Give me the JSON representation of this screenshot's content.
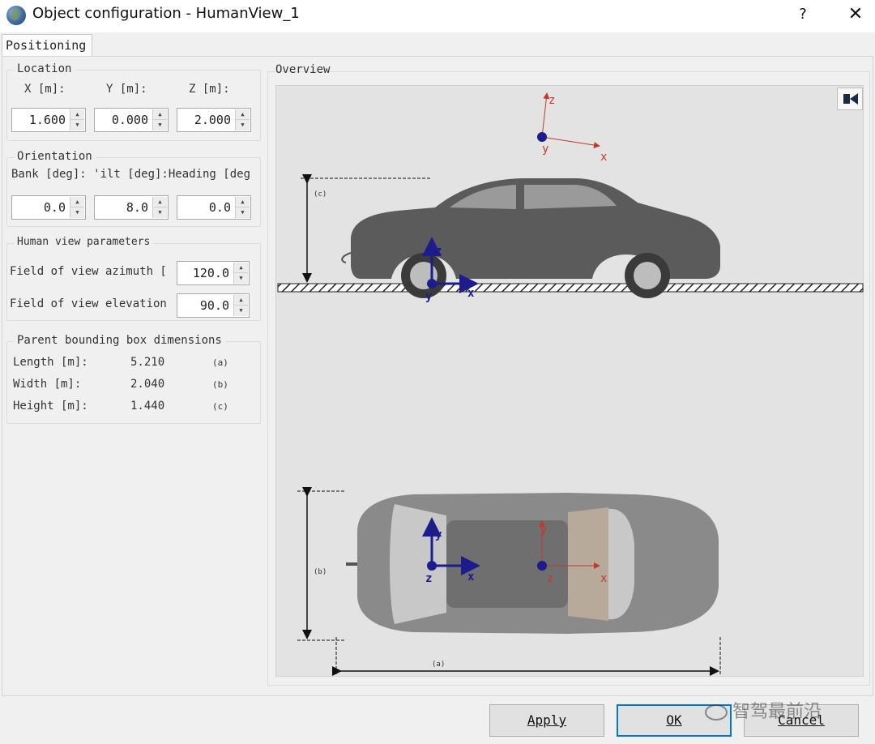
{
  "window": {
    "title": "Object configuration - HumanView_1",
    "help_label": "?",
    "close_label": "✕"
  },
  "tabs": [
    {
      "label": "Positioning"
    }
  ],
  "location": {
    "title": "Location",
    "x_label": "X [m]:",
    "y_label": "Y [m]:",
    "z_label": "Z [m]:",
    "x_value": "1.600",
    "y_value": "0.000",
    "z_value": "2.000"
  },
  "orientation": {
    "title": "Orientation",
    "labels_text": "Bank [deg]: 'ilt [deg]:Heading [deg",
    "bank_value": "0.0",
    "tilt_value": "8.0",
    "heading_value": "0.0"
  },
  "human_view": {
    "title": "Human view parameters",
    "azimuth_label": "Field of view azimuth [",
    "azimuth_value": "120.0",
    "elevation_label": "Field of view elevation",
    "elevation_value": "90.0"
  },
  "bbox": {
    "title": "Parent bounding box dimensions",
    "rows": [
      {
        "label": "Length [m]:",
        "value": "5.210",
        "tag": "(a)"
      },
      {
        "label": "Width [m]:",
        "value": "2.040",
        "tag": "(b)"
      },
      {
        "label": "Height [m]:",
        "value": "1.440",
        "tag": "(c)"
      }
    ]
  },
  "overview": {
    "title": "Overview",
    "camera_icon": "camera-toggle-icon",
    "axis_x": "x",
    "axis_y": "y",
    "axis_z": "z",
    "dim_a": "(a)",
    "dim_b": "(b)",
    "dim_c": "(c)"
  },
  "buttons": {
    "apply": "Apply",
    "ok": "OK",
    "cancel": "Cancel"
  },
  "watermark": "智驾最前沿",
  "colors": {
    "parent_axis": "#1c1c8c",
    "sensor_axis": "#c0392b",
    "car": "#5b5b5b",
    "default_button_border": "#0078d7"
  }
}
